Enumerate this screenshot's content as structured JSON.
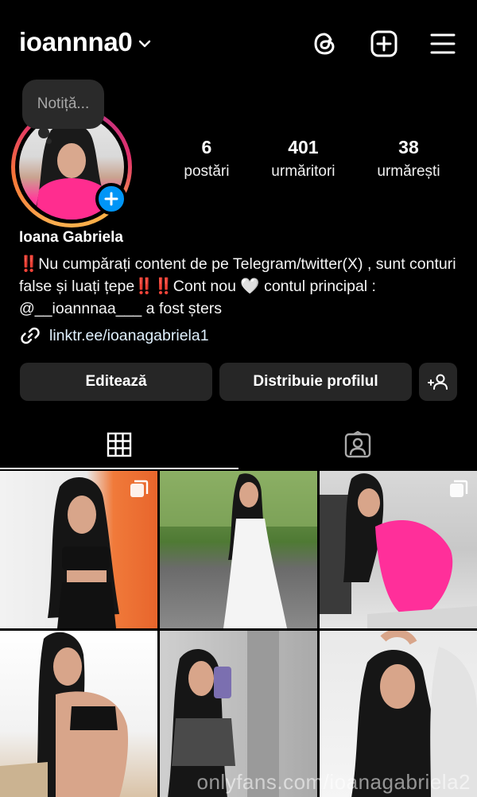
{
  "header": {
    "username": "ioannna0",
    "icons": [
      "chevron-down-icon",
      "threads-icon",
      "add-post-icon",
      "menu-icon"
    ]
  },
  "note": {
    "placeholder": "Notiță..."
  },
  "profile": {
    "stats": [
      {
        "value": "6",
        "label": "postări"
      },
      {
        "value": "401",
        "label": "urmăritori"
      },
      {
        "value": "38",
        "label": "urmărești"
      }
    ],
    "name": "Ioana Gabriela",
    "bio": "‼️Nu cumpărați content de pe Telegram/twitter(X) , sunt conturi false și luați țepe‼️‼️Cont nou 🤍 contul principal : @__ioannnaa___ a fost șters",
    "link": "linktr.ee/ioanagabriela1"
  },
  "actions": {
    "edit_label": "Editează",
    "share_label": "Distribuie profilul"
  },
  "tabs": [
    "grid-icon",
    "tagged-icon"
  ],
  "grid": {
    "posts": [
      {
        "multi": true
      },
      {
        "multi": false
      },
      {
        "multi": true
      },
      {
        "multi": false
      },
      {
        "multi": false
      },
      {
        "multi": false
      }
    ]
  },
  "watermark": "onlyfans.com/ioanagabriela2",
  "colors": {
    "accent": "#0095f6",
    "button_bg": "#262626",
    "background": "#000000"
  }
}
